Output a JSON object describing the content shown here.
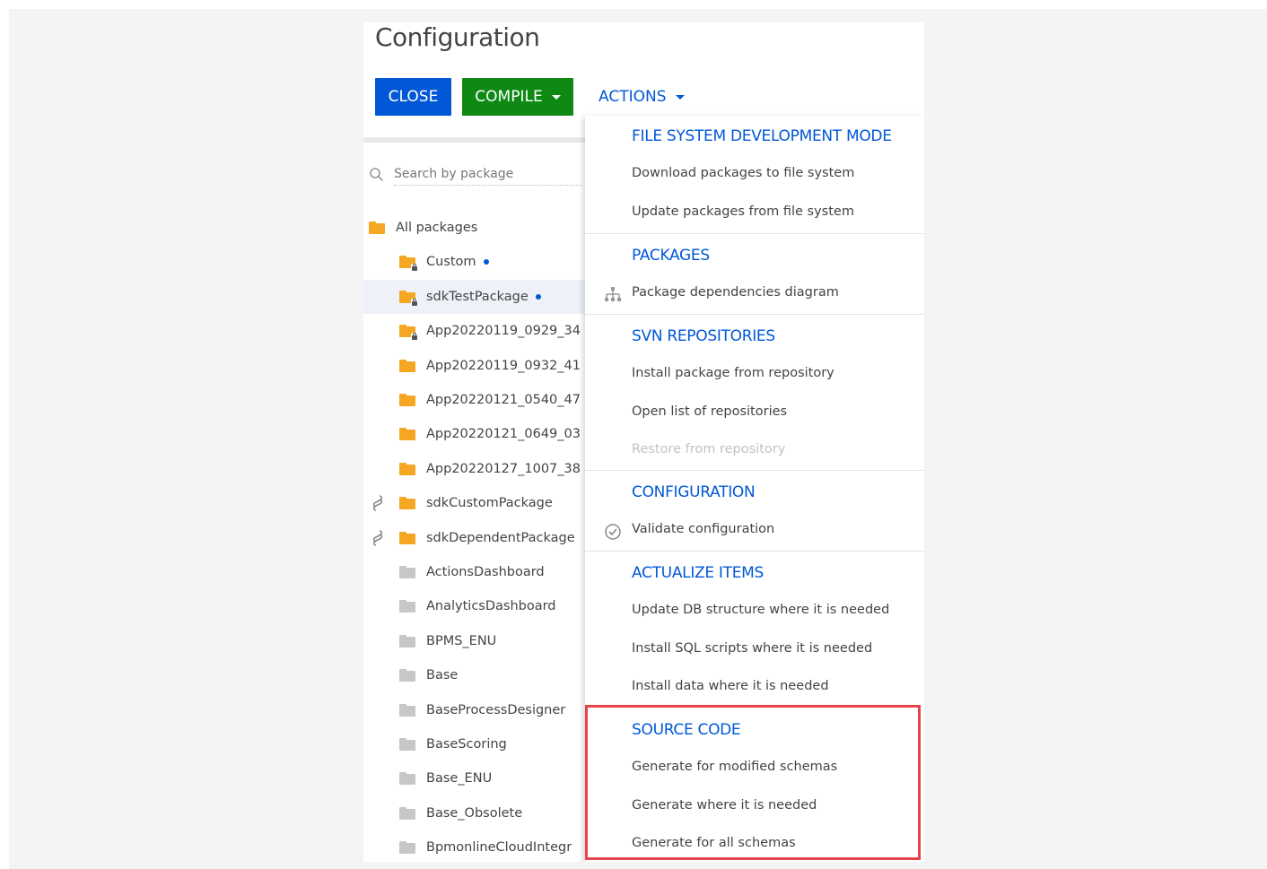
{
  "page": {
    "title": "Configuration"
  },
  "toolbar": {
    "close_label": "CLOSE",
    "compile_label": "COMPILE",
    "actions_label": "ACTIONS"
  },
  "search": {
    "placeholder": "Search by package"
  },
  "tree": {
    "root_label": "All packages",
    "items": [
      {
        "label": "Custom",
        "icon": "folder-locked-icon",
        "modified": true
      },
      {
        "label": "sdkTestPackage",
        "icon": "folder-locked-icon",
        "modified": true,
        "selected": true
      },
      {
        "label": "App20220119_0929_34",
        "icon": "folder-locked-icon"
      },
      {
        "label": "App20220119_0932_41",
        "icon": "folder-icon"
      },
      {
        "label": "App20220121_0540_47",
        "icon": "folder-icon"
      },
      {
        "label": "App20220121_0649_03",
        "icon": "folder-icon"
      },
      {
        "label": "App20220127_1007_38",
        "icon": "folder-icon"
      },
      {
        "label": "sdkCustomPackage",
        "icon": "folder-icon",
        "linked": true
      },
      {
        "label": "sdkDependentPackage",
        "icon": "folder-icon",
        "linked": true
      },
      {
        "label": "ActionsDashboard",
        "icon": "folder-grey-icon"
      },
      {
        "label": "AnalyticsDashboard",
        "icon": "folder-grey-icon"
      },
      {
        "label": "BPMS_ENU",
        "icon": "folder-grey-icon"
      },
      {
        "label": "Base",
        "icon": "folder-grey-icon"
      },
      {
        "label": "BaseProcessDesigner",
        "icon": "folder-grey-icon"
      },
      {
        "label": "BaseScoring",
        "icon": "folder-grey-icon"
      },
      {
        "label": "Base_ENU",
        "icon": "folder-grey-icon"
      },
      {
        "label": "Base_Obsolete",
        "icon": "folder-grey-icon"
      },
      {
        "label": "BpmonlineCloudIntegr",
        "icon": "folder-grey-icon"
      }
    ]
  },
  "actions_menu": {
    "sections": [
      {
        "header": "FILE SYSTEM DEVELOPMENT MODE",
        "items": [
          "Download packages to file system",
          "Update packages from file system"
        ]
      },
      {
        "header": "PACKAGES",
        "items": [
          "Package dependencies diagram"
        ]
      },
      {
        "header": "SVN REPOSITORIES",
        "items": [
          "Install package from repository",
          "Open list of repositories",
          "Restore from repository"
        ]
      },
      {
        "header": "CONFIGURATION",
        "items": [
          "Validate configuration"
        ]
      },
      {
        "header": "ACTUALIZE ITEMS",
        "items": [
          "Update DB structure where it is needed",
          "Install SQL scripts where it is needed",
          "Install data where it is needed"
        ]
      },
      {
        "header": "SOURCE CODE",
        "items": [
          "Generate for modified schemas",
          "Generate where it is needed",
          "Generate for all schemas"
        ]
      }
    ]
  },
  "colors": {
    "close_button": "#0058d6",
    "compile_button": "#0e8a14",
    "accent_link": "#0058d6",
    "highlight_box": "#e8434b",
    "folder_orange": "#f5a623",
    "folder_grey": "#c7c7c7"
  }
}
